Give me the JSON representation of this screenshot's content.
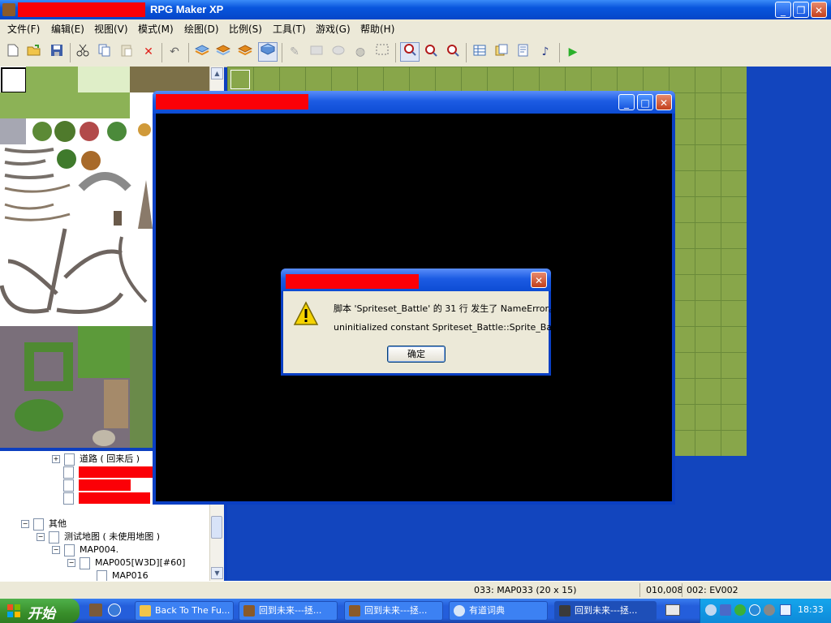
{
  "app": {
    "title": "RPG Maker XP",
    "window_buttons": {
      "minimize": "_",
      "restore": "❐",
      "close": "✕"
    }
  },
  "menu": [
    {
      "label": "文件(F)"
    },
    {
      "label": "编辑(E)"
    },
    {
      "label": "视图(V)"
    },
    {
      "label": "模式(M)"
    },
    {
      "label": "绘图(D)"
    },
    {
      "label": "比例(S)"
    },
    {
      "label": "工具(T)"
    },
    {
      "label": "游戏(G)"
    },
    {
      "label": "帮助(H)"
    }
  ],
  "toolbar": {
    "tools": [
      "new-icon",
      "open-icon",
      "save-icon",
      "cut-icon",
      "copy-icon",
      "paste-icon",
      "delete-icon",
      "undo-icon",
      "layer1-icon",
      "layer2-icon",
      "layer3-icon",
      "event-layer-icon",
      "pencil-icon",
      "rectangle-icon",
      "ellipse-icon",
      "fill-icon",
      "select-icon",
      "zoom-1-1-icon",
      "zoom-1-2-icon",
      "zoom-1-4-icon",
      "database-icon",
      "material-icon",
      "script-editor-icon",
      "sound-test-icon",
      "playtest-icon"
    ],
    "pressed": [
      "event-layer-icon",
      "zoom-1-1-icon"
    ]
  },
  "tree": {
    "items": [
      {
        "label": "道路 ( 回来后 )",
        "expander": "+"
      },
      {
        "label": "",
        "expander": ""
      },
      {
        "label": "",
        "expander": ""
      },
      {
        "label": "",
        "expander": ""
      },
      {
        "label": "其他",
        "expander": "−"
      },
      {
        "label": "测试地图 ( 未使用地图 )",
        "expander": "−"
      },
      {
        "label": "MAP004.",
        "expander": "−"
      },
      {
        "label": "MAP005[W3D][#60]",
        "expander": "−"
      },
      {
        "label": "MAP016",
        "expander": ""
      }
    ]
  },
  "status": {
    "map": "033: MAP033 (20 x 15)",
    "coords": "010,008",
    "event": "002: EV002"
  },
  "game_window": {
    "buttons": {
      "minimize": "_",
      "maximize": "□",
      "close": "✕"
    }
  },
  "dialog": {
    "line1": "脚本 'Spriteset_Battle' 的 31 行 发生了 NameError。",
    "line2": "uninitialized constant Spriteset_Battle::Sprite_Battler",
    "ok": "确定",
    "close": "✕"
  },
  "taskbar": {
    "start": "开始",
    "tasks": [
      {
        "label": "Back To The Fu..."
      },
      {
        "label": "回到未来---拯..."
      },
      {
        "label": "回到未来---拯..."
      },
      {
        "label": "有道词典"
      },
      {
        "label": "回到未来---拯..."
      }
    ],
    "clock": "18:33"
  },
  "colors": {
    "redaction": "#fb0007",
    "xp_blue": "#0855dd",
    "grass": "#88a64a",
    "map_water": "#1245be"
  }
}
